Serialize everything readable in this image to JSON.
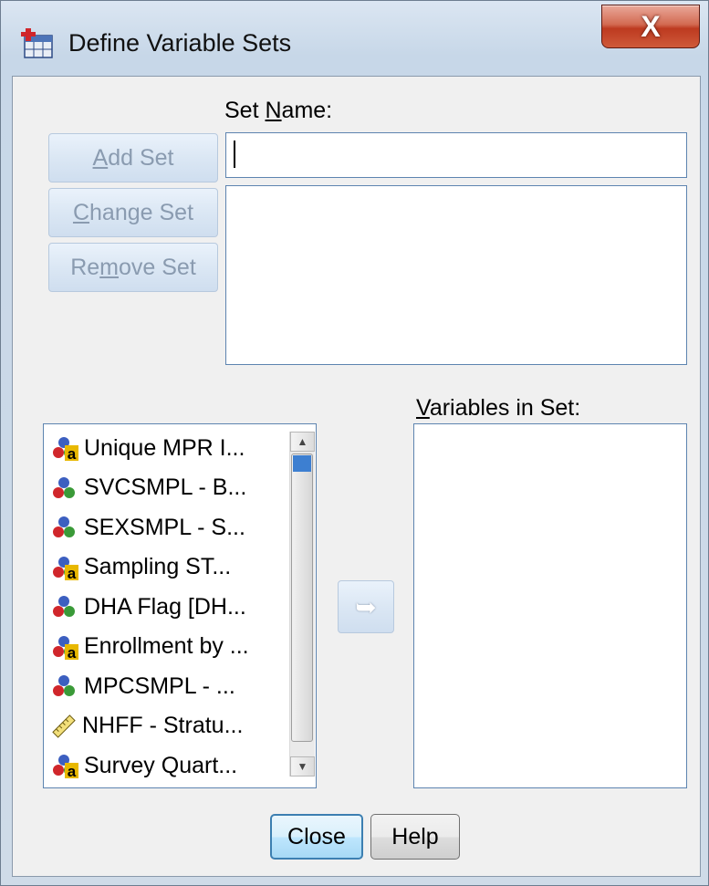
{
  "window": {
    "title": "Define Variable Sets",
    "close_glyph": "X"
  },
  "set_name": {
    "label_prefix": "Set ",
    "label_accel": "N",
    "label_rest": "ame:",
    "value": ""
  },
  "buttons": {
    "add_set": {
      "accel": "A",
      "rest": "dd Set"
    },
    "change_set": {
      "accel": "C",
      "rest": "hange Set"
    },
    "remove_set": {
      "pre": "Re",
      "accel": "m",
      "rest": "ove Set"
    },
    "move_arrow_glyph": "➥",
    "close": "Close",
    "help": "Help"
  },
  "variables_in_set": {
    "label_accel": "V",
    "label_rest": "ariables in Set:",
    "items": []
  },
  "source_variables": [
    {
      "label": "Unique MPR I...",
      "icon": "nominal-string-icon"
    },
    {
      "label": "SVCSMPL - B...",
      "icon": "nominal-icon"
    },
    {
      "label": "SEXSMPL - S...",
      "icon": "nominal-icon"
    },
    {
      "label": "Sampling ST...",
      "icon": "nominal-string-icon"
    },
    {
      "label": "DHA Flag [DH...",
      "icon": "nominal-icon"
    },
    {
      "label": "Enrollment by ...",
      "icon": "nominal-string-icon"
    },
    {
      "label": "MPCSMPL - ...",
      "icon": "nominal-icon"
    },
    {
      "label": "NHFF - Stratu...",
      "icon": "scale-ruler-icon"
    },
    {
      "label": "Survey Quart...",
      "icon": "nominal-string-icon"
    }
  ],
  "colors": {
    "red": "#d0262b",
    "green": "#3a9a38",
    "blue": "#3c5fc0",
    "string_a": "#e8b800"
  }
}
